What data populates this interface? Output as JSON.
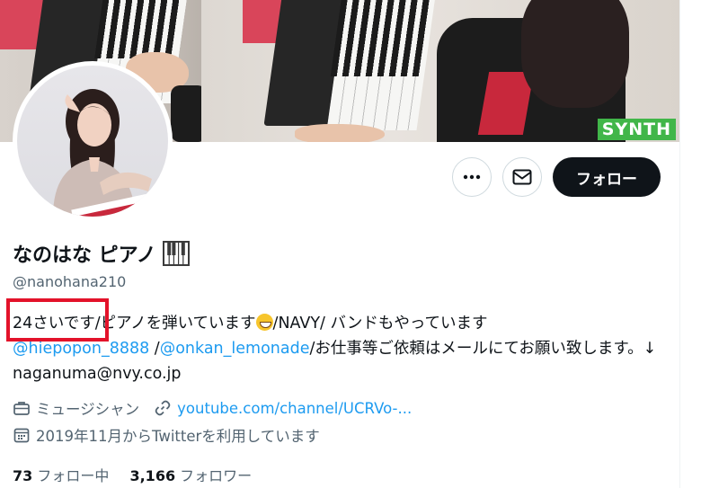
{
  "banner": {
    "badge": "SYNTH"
  },
  "profile": {
    "name": "なのはな ピアノ",
    "handle": "@nanohana210",
    "follow_label": "フォロー"
  },
  "bio": {
    "part1": "24さいです/ピアノを弾いています",
    "part2": "/NAVY/ バンドもやっています",
    "mention1": "@hiepopon_8888",
    "sep": " /",
    "mention2": "@onkan_lemonade",
    "part3": "/お仕事等ご依頼はメールにてお願い致します。↓ naganuma@nvy.co.jp"
  },
  "meta": {
    "job": "ミュージシャン",
    "link": "youtube.com/channel/UCRVo-...",
    "joined": "2019年11月からTwitterを利用しています"
  },
  "stats": {
    "following_count": "73",
    "following_label": "フォロー中",
    "followers_count": "3,166",
    "followers_label": "フォロワー"
  },
  "icons": {
    "more": "more-dots-icon",
    "message": "mail-icon",
    "job": "briefcase-icon",
    "link": "link-icon",
    "joined": "calendar-icon",
    "emoji": "grinning-face-icon",
    "name_emoji": "piano-keys-icon"
  },
  "colors": {
    "accent": "#1d9bf0",
    "follow_bg": "#0f1419",
    "highlight": "#e3122a",
    "badge": "#41b649"
  }
}
